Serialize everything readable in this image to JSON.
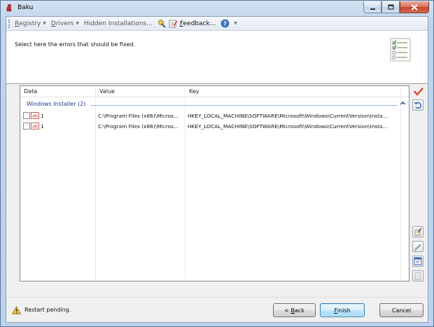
{
  "window": {
    "title": "Baku",
    "minimize_icon": "minimize-icon",
    "maximize_icon": "maximize-icon",
    "close_icon": "close-icon"
  },
  "menubar": {
    "registry": {
      "label": "Registry",
      "mnemonic": "R"
    },
    "drivers": {
      "label": "Drivers",
      "mnemonic": "D"
    },
    "hidden": "Hidden Installations...",
    "feedback": {
      "label": "Feedback...",
      "mnemonic": "F"
    },
    "help_icon": "help-icon"
  },
  "header": {
    "instruction": "Select here the errors that should be fixed.",
    "icon": "checklist-icon"
  },
  "grid": {
    "columns": [
      "Data",
      "Value",
      "Key"
    ],
    "group": {
      "label": "Windows Installer (2)",
      "collapse_icon": "chevron-up-icon"
    },
    "rows": [
      {
        "checked": false,
        "icon": "string-value-icon",
        "data": "1",
        "value": "C:\\Program Files (x86)\\Micros...",
        "key": "HKEY_LOCAL_MACHINE\\SOFTWARE\\Microsoft\\Windows\\CurrentVersion\\Insta..."
      },
      {
        "checked": false,
        "icon": "string-value-icon",
        "data": "1",
        "value": "C:\\Program Files (x86)\\Micros...",
        "key": "HKEY_LOCAL_MACHINE\\SOFTWARE\\Microsoft\\Windows\\CurrentVersion\\Insta..."
      }
    ]
  },
  "side_tools": {
    "check_all": "checkmark-icon",
    "undo": "undo-icon",
    "tool1": "wrench-icon",
    "tool2": "edit-icon",
    "tool3": "properties-icon",
    "tool4": "disabled-tool-icon"
  },
  "footer": {
    "status_icon": "warning-icon",
    "status": "Restart pending.",
    "back": {
      "prefix": "< ",
      "mnemonic": "B",
      "rest": "ack"
    },
    "finish": {
      "mnemonic": "F",
      "rest": "inish"
    },
    "cancel": "Cancel"
  },
  "colors": {
    "group_text": "#1e3a8f",
    "accent_button": "#a7d9f5",
    "window_frame": "#bdd3ec"
  }
}
